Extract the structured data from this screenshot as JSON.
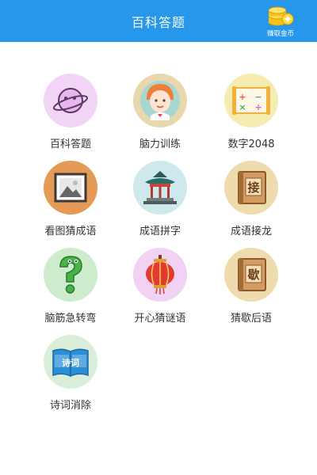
{
  "header": {
    "title": "百科答题",
    "earn_label": "赚取金币"
  },
  "tiles": [
    {
      "label": "百科答题",
      "icon": "planet-icon",
      "bg": "#f2d4f7"
    },
    {
      "label": "脑力训练",
      "icon": "child-avatar-icon",
      "bg": "#e9d8ad"
    },
    {
      "label": "数字2048",
      "icon": "math-board-icon",
      "bg": "#f6ebb0"
    },
    {
      "label": "看图猜成语",
      "icon": "picture-frame-icon",
      "bg": "#e59a57"
    },
    {
      "label": "成语拼字",
      "icon": "pavilion-icon",
      "bg": "#cfe8ec"
    },
    {
      "label": "成语接龙",
      "icon": "book-jie-icon",
      "bg": "#efdcae",
      "badge": "接"
    },
    {
      "label": "脑筋急转弯",
      "icon": "question-creature-icon",
      "bg": "#cdeccd"
    },
    {
      "label": "开心猜谜语",
      "icon": "lantern-icon",
      "bg": "#f2d2f2"
    },
    {
      "label": "猜歇后语",
      "icon": "book-xie-icon",
      "bg": "#efdcae",
      "badge": "歇"
    },
    {
      "label": "诗词消除",
      "icon": "poem-book-icon",
      "bg": "#d9efd9",
      "badge": "诗词"
    }
  ]
}
